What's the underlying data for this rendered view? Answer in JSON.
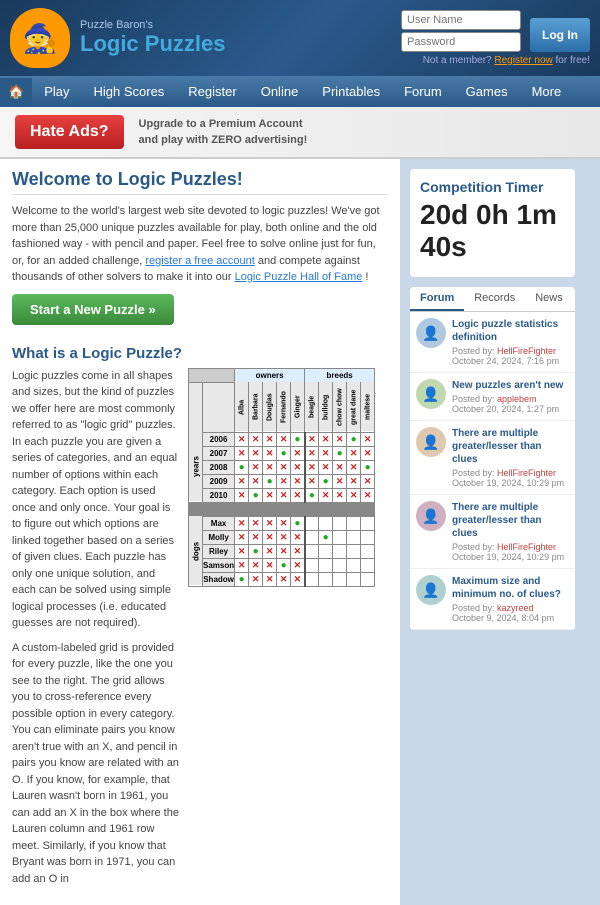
{
  "header": {
    "logo_subtitle": "Puzzle Baron's",
    "logo_title": "Logic Puzzles",
    "mascot_emoji": "🧙",
    "login_username_placeholder": "User Name",
    "login_password_placeholder": "Password",
    "login_button": "Log In",
    "register_text": "Not a member?",
    "register_link_text": "Register now",
    "register_suffix": "for free!"
  },
  "nav": {
    "home_icon": "🏠",
    "items": [
      "Play",
      "High Scores",
      "Register",
      "Online",
      "Printables",
      "Forum",
      "Games",
      "More"
    ]
  },
  "ad_banner": {
    "hate_ads": "Hate Ads?",
    "line1": "Upgrade to a Premium Account",
    "line2": "and play with",
    "zero": "ZERO",
    "line3": "advertising!"
  },
  "welcome": {
    "title": "Welcome to Logic Puzzles!",
    "body": "Welcome to the world's largest web site devoted to logic puzzles! We've got more than 25,000 unique puzzles available for play, both online and the old fashioned way - with pencil and paper. Feel free to solve online just for fun, or, for an added challenge,",
    "register_link": "register a free account",
    "body2": "and compete against thousands of other solvers to make it into our",
    "hall_link": "Logic Puzzle Hall of Fame",
    "body3": "!",
    "start_button": "Start a New Puzzle »"
  },
  "what_is": {
    "title": "What is a Logic Puzzle?",
    "para1": "Logic puzzles come in all shapes and sizes, but the kind of puzzles we offer here are most commonly referred to as \"logic grid\" puzzles. In each puzzle you are given a series of categories, and an equal number of options within each category. Each option is used once and only once. Your goal is to figure out which options are linked together based on a series of given clues. Each puzzle has only one unique solution, and each can be solved using simple logical processes (i.e. educated guesses are not required).",
    "para2": "A custom-labeled grid is provided for every puzzle, like the one you see to the right. The grid allows you to cross-reference every possible option in every category. You can eliminate pairs you know aren't true with an X, and pencil in pairs you know are related with an O. If you know, for example, that Lauren wasn't born in 1961, you can add an X in the box where the Lauren column and 1961 row meet. Similarly, if you know that Bryant was born in 1971, you can add an O in"
  },
  "grid": {
    "col_headers": [
      "Alba",
      "Barbara",
      "Douglas",
      "Fernando",
      "Ginger",
      "beagle",
      "bulldog",
      "chow chow",
      "great dane",
      "maltese"
    ],
    "row_sections": [
      {
        "section_label": "years",
        "rows": [
          {
            "label": "2006",
            "cells": [
              "X",
              "X",
              "X",
              "X",
              "O",
              "X",
              "X",
              "X",
              "O",
              "X"
            ]
          },
          {
            "label": "2007",
            "cells": [
              "X",
              "X",
              "X",
              "O",
              "X",
              "X",
              "X",
              "O",
              "X",
              "X"
            ]
          },
          {
            "label": "2008",
            "cells": [
              "O",
              "X",
              "X",
              "X",
              "X",
              "X",
              "X",
              "X",
              "X",
              "O"
            ]
          },
          {
            "label": "2009",
            "cells": [
              "X",
              "X",
              "O",
              "X",
              "X",
              "X",
              "O",
              "X",
              "X",
              "X"
            ]
          },
          {
            "label": "2010",
            "cells": [
              "X",
              "O",
              "X",
              "X",
              "X",
              "O",
              "X",
              "X",
              "X",
              "X"
            ]
          }
        ]
      },
      {
        "section_label": "dogs",
        "rows": [
          {
            "label": "Max",
            "cells": [
              "X",
              "X",
              "X",
              "X",
              "O",
              "",
              "",
              "",
              "",
              ""
            ]
          },
          {
            "label": "Molly",
            "cells": [
              "X",
              "X",
              "X",
              "X",
              "X",
              "",
              "O",
              "",
              "",
              ""
            ]
          },
          {
            "label": "Riley",
            "cells": [
              "X",
              "O",
              "X",
              "X",
              "X",
              "",
              "",
              "",
              "",
              ""
            ]
          },
          {
            "label": "Samson",
            "cells": [
              "X",
              "X",
              "X",
              "O",
              "X",
              "",
              "",
              "",
              "",
              ""
            ]
          },
          {
            "label": "Shadow",
            "cells": [
              "O",
              "X",
              "X",
              "X",
              "X",
              "",
              "",
              "",
              "",
              ""
            ]
          }
        ]
      }
    ]
  },
  "sidebar": {
    "competition_timer_label": "Competition Timer",
    "timer": "20d 0h 1m 40s",
    "forum_tabs": [
      "Forum",
      "Records",
      "News"
    ],
    "active_tab": "Forum",
    "forum_items": [
      {
        "title": "Logic puzzle statistics definition",
        "poster": "HellFireFighter",
        "date": "October 24, 2024, 7:16 pm"
      },
      {
        "title": "New puzzles aren't new",
        "poster": "applebem",
        "date": "October 20, 2024, 1:27 pm"
      },
      {
        "title": "There are multiple greater/lesser than clues",
        "poster": "HellFireFighter",
        "date": "October 19, 2024, 10:29 pm"
      },
      {
        "title": "There are multiple greater/lesser than clues",
        "poster": "HellFireFighter",
        "date": "October 19, 2024, 10:29 pm"
      },
      {
        "title": "Maximum size and minimum no. of clues?",
        "poster": "kazyreed",
        "date": "October 9, 2024, 8:04 pm"
      }
    ]
  }
}
